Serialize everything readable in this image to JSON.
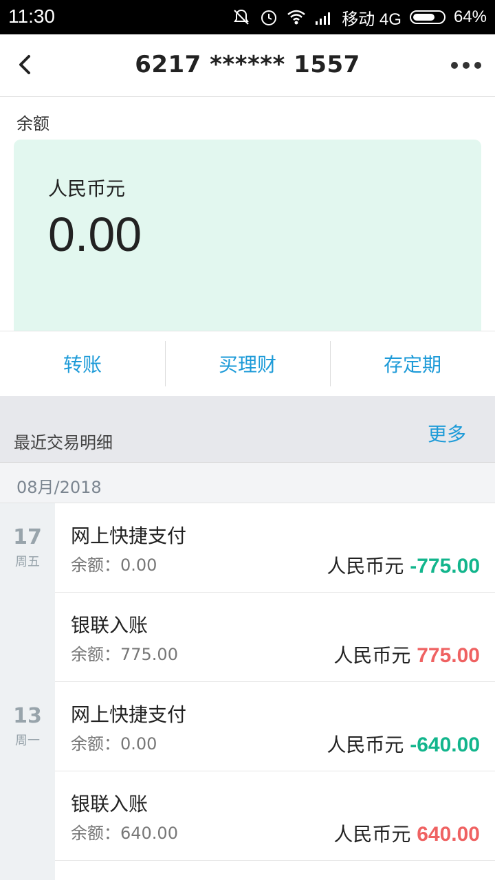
{
  "status_bar": {
    "time": "11:30",
    "carrier": "移动 4G",
    "battery": "64%",
    "icons": [
      "mute-bell-icon",
      "alarm-icon",
      "wifi-icon",
      "signal-icon",
      "battery-icon"
    ]
  },
  "header": {
    "title": "6217 ****** 1557",
    "back_icon": "chevron-left-icon",
    "more_icon": "more-dots-icon"
  },
  "balance": {
    "label": "余额",
    "currency": "人民币元",
    "amount": "0.00",
    "card_color": "#e2f7ef"
  },
  "actions": [
    {
      "label": "转账"
    },
    {
      "label": "买理财"
    },
    {
      "label": "存定期"
    }
  ],
  "recent": {
    "title": "最近交易明细",
    "more": "更多",
    "month": "08月/2018"
  },
  "date_groups": [
    {
      "day": "17",
      "weekday": "周五"
    },
    {
      "day": "13",
      "weekday": "周一"
    }
  ],
  "transactions": [
    {
      "name": "网上快捷支付",
      "balance": "余额：0.00",
      "currency": "人民币元",
      "amount": "-775.00",
      "type": "debit"
    },
    {
      "name": "银联入账",
      "balance": "余额：775.00",
      "currency": "人民币元",
      "amount": "775.00",
      "type": "credit"
    },
    {
      "name": "网上快捷支付",
      "balance": "余额：0.00",
      "currency": "人民币元",
      "amount": "-640.00",
      "type": "debit"
    },
    {
      "name": "银联入账",
      "balance": "余额：640.00",
      "currency": "人民币元",
      "amount": "640.00",
      "type": "credit"
    }
  ],
  "colors": {
    "accent": "#1e9bd8",
    "debit": "#12b58c",
    "credit": "#ef6262"
  }
}
